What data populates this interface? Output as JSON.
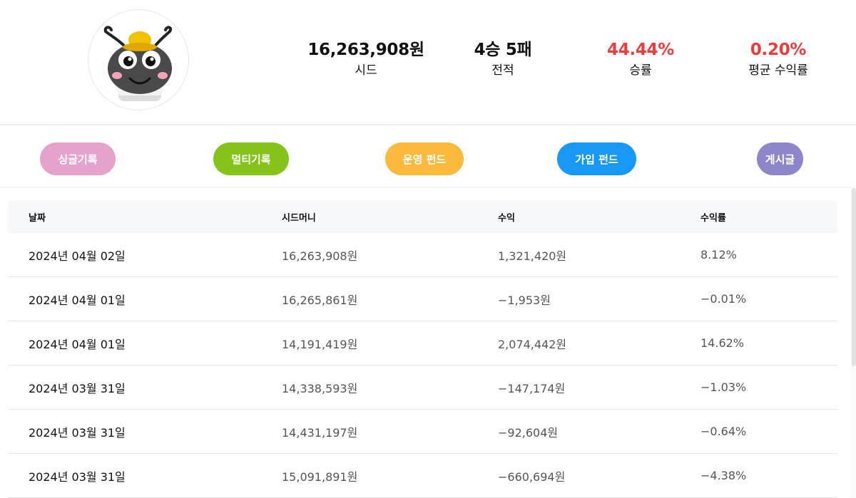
{
  "profile": {
    "avatar": "ant-character-with-yellow-hat",
    "stats": [
      {
        "value": "16,263,908원",
        "label": "시드",
        "highlight": false
      },
      {
        "value": "4승 5패",
        "label": "전적",
        "highlight": false
      },
      {
        "value": "44.44%",
        "label": "승률",
        "highlight": true
      },
      {
        "value": "0.20%",
        "label": "평균 수익률",
        "highlight": true
      }
    ]
  },
  "tabs": [
    {
      "label": "싱글기록",
      "color": "#e5a3cc"
    },
    {
      "label": "멀티기록",
      "color": "#84c41a"
    },
    {
      "label": "운영 펀드",
      "color": "#fbba3b"
    },
    {
      "label": "가입 펀드",
      "color": "#1898f5"
    },
    {
      "label": "게시글",
      "color": "#8c86ca"
    }
  ],
  "table": {
    "headers": [
      "날짜",
      "시드머니",
      "수익",
      "수익률"
    ],
    "rows": [
      [
        "2024년 04월 02일",
        "16,263,908원",
        "1,321,420원",
        "8.12%"
      ],
      [
        "2024년 04월 01일",
        "16,265,861원",
        "−1,953원",
        "−0.01%"
      ],
      [
        "2024년 04월 01일",
        "14,191,419원",
        "2,074,442원",
        "14.62%"
      ],
      [
        "2024년 03월 31일",
        "14,338,593원",
        "−147,174원",
        "−1.03%"
      ],
      [
        "2024년 03월 31일",
        "14,431,197원",
        "−92,604원",
        "−0.64%"
      ],
      [
        "2024년 03월 31일",
        "15,091,891원",
        "−660,694원",
        "−4.38%"
      ]
    ]
  },
  "colors": {
    "accent_red": "#ee3c3c"
  }
}
